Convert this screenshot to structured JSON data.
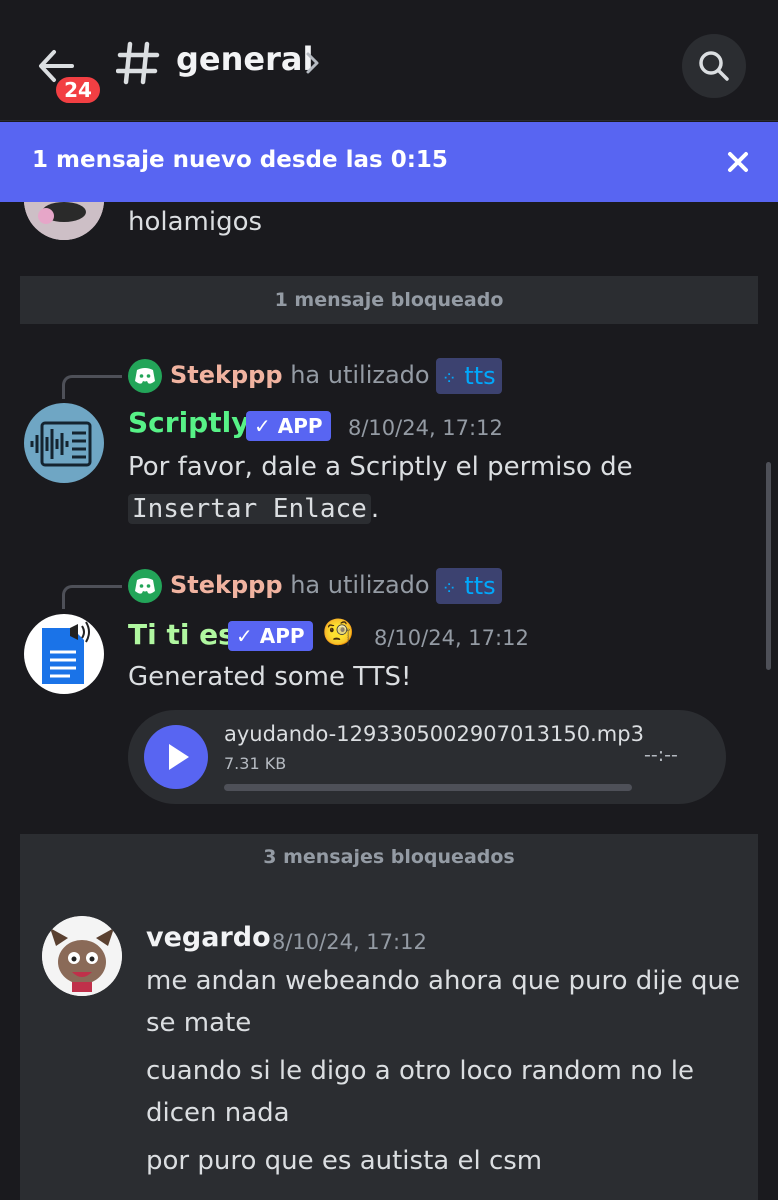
{
  "header": {
    "unread_badge": "24",
    "channel_name": "general"
  },
  "banner": {
    "text": "1 mensaje nuevo desde las 0:15"
  },
  "messages": {
    "prev_text": "holamigos",
    "blocked_1": "1 mensaje bloqueado",
    "scriptly": {
      "ctx_user": "Stekppp",
      "ctx_used": "ha utilizado",
      "ctx_cmd": "tts",
      "author": "Scriptly",
      "app_tag": "APP",
      "timestamp": "8/10/24, 17:12",
      "line1": "Por favor, dale a Scriptly el permiso de",
      "line2_code": "Insertar Enlace",
      "line2_end": "."
    },
    "titi": {
      "ctx_user": "Stekppp",
      "ctx_used": "ha utilizado",
      "ctx_cmd": "tts",
      "author": "Ti ti es",
      "app_tag": "APP",
      "emoji": "🧐",
      "timestamp": "8/10/24, 17:12",
      "text": "Generated some TTS!",
      "audio": {
        "file_name": "ayudando-1293305002907013150.mp3",
        "file_size": "7.31 KB",
        "duration": "--:--",
        "progress": 0
      }
    },
    "blocked_3": "3 mensajes bloqueados",
    "vegardo": {
      "author": "vegardo",
      "timestamp": "8/10/24, 17:12",
      "lines": [
        "me andan webeando ahora que puro dije que",
        "se mate",
        "cuando si le digo a otro loco random no le",
        "dicen nada",
        "por puro que es autista el csm"
      ]
    }
  },
  "colors": {
    "accent": "#5865f2",
    "scriptly_name": "#57f287",
    "titi_name": "#b0f7a0",
    "ctx_user": "#f0b3a0"
  }
}
